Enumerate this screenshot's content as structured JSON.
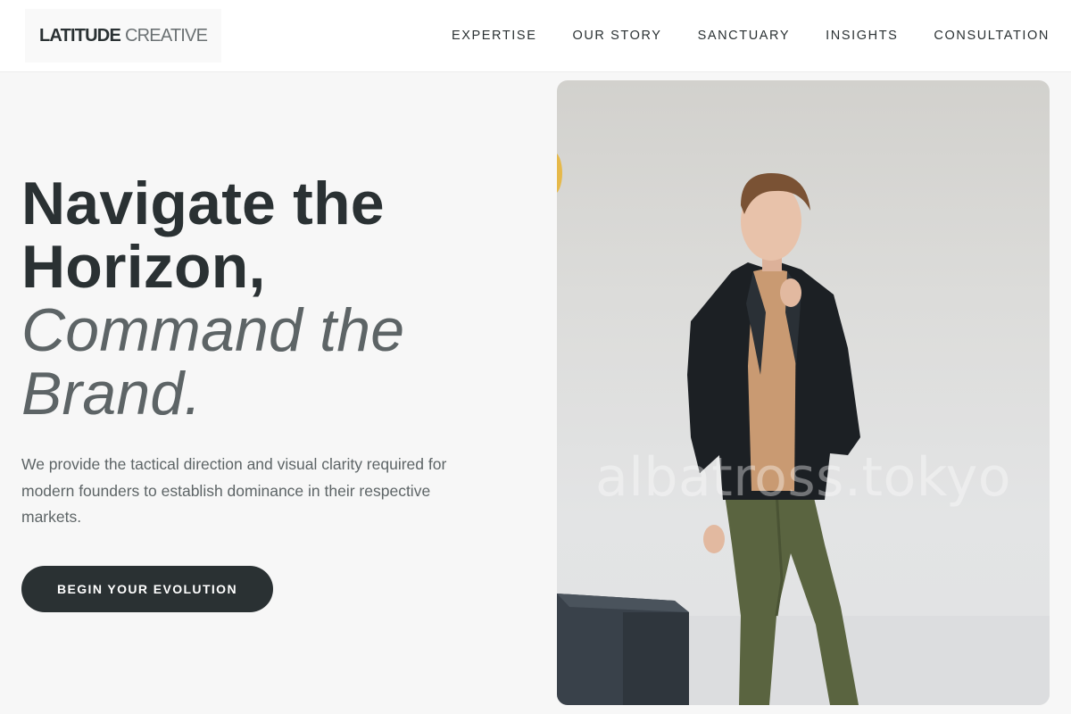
{
  "brand": {
    "name_strong": "LATITUDE",
    "name_light": "CREATIVE"
  },
  "nav": {
    "items": [
      {
        "label": "EXPERTISE"
      },
      {
        "label": "OUR STORY"
      },
      {
        "label": "SANCTUARY"
      },
      {
        "label": "INSIGHTS"
      },
      {
        "label": "CONSULTATION"
      }
    ]
  },
  "hero": {
    "title_line1": "Navigate the",
    "title_line2": "Horizon,",
    "title_accent_line1": "Command the",
    "title_accent_line2": "Brand.",
    "subtitle": "We provide the tactical direction and visual clarity required for modern founders to establish dominance in their respective markets.",
    "cta_label": "BEGIN YOUR EVOLUTION",
    "image_watermark": "albatross.tokyo"
  },
  "colors": {
    "text_primary": "#2a3133",
    "text_muted": "#5d6466",
    "cta_background": "#2a3133",
    "page_background": "#f7f7f7"
  }
}
